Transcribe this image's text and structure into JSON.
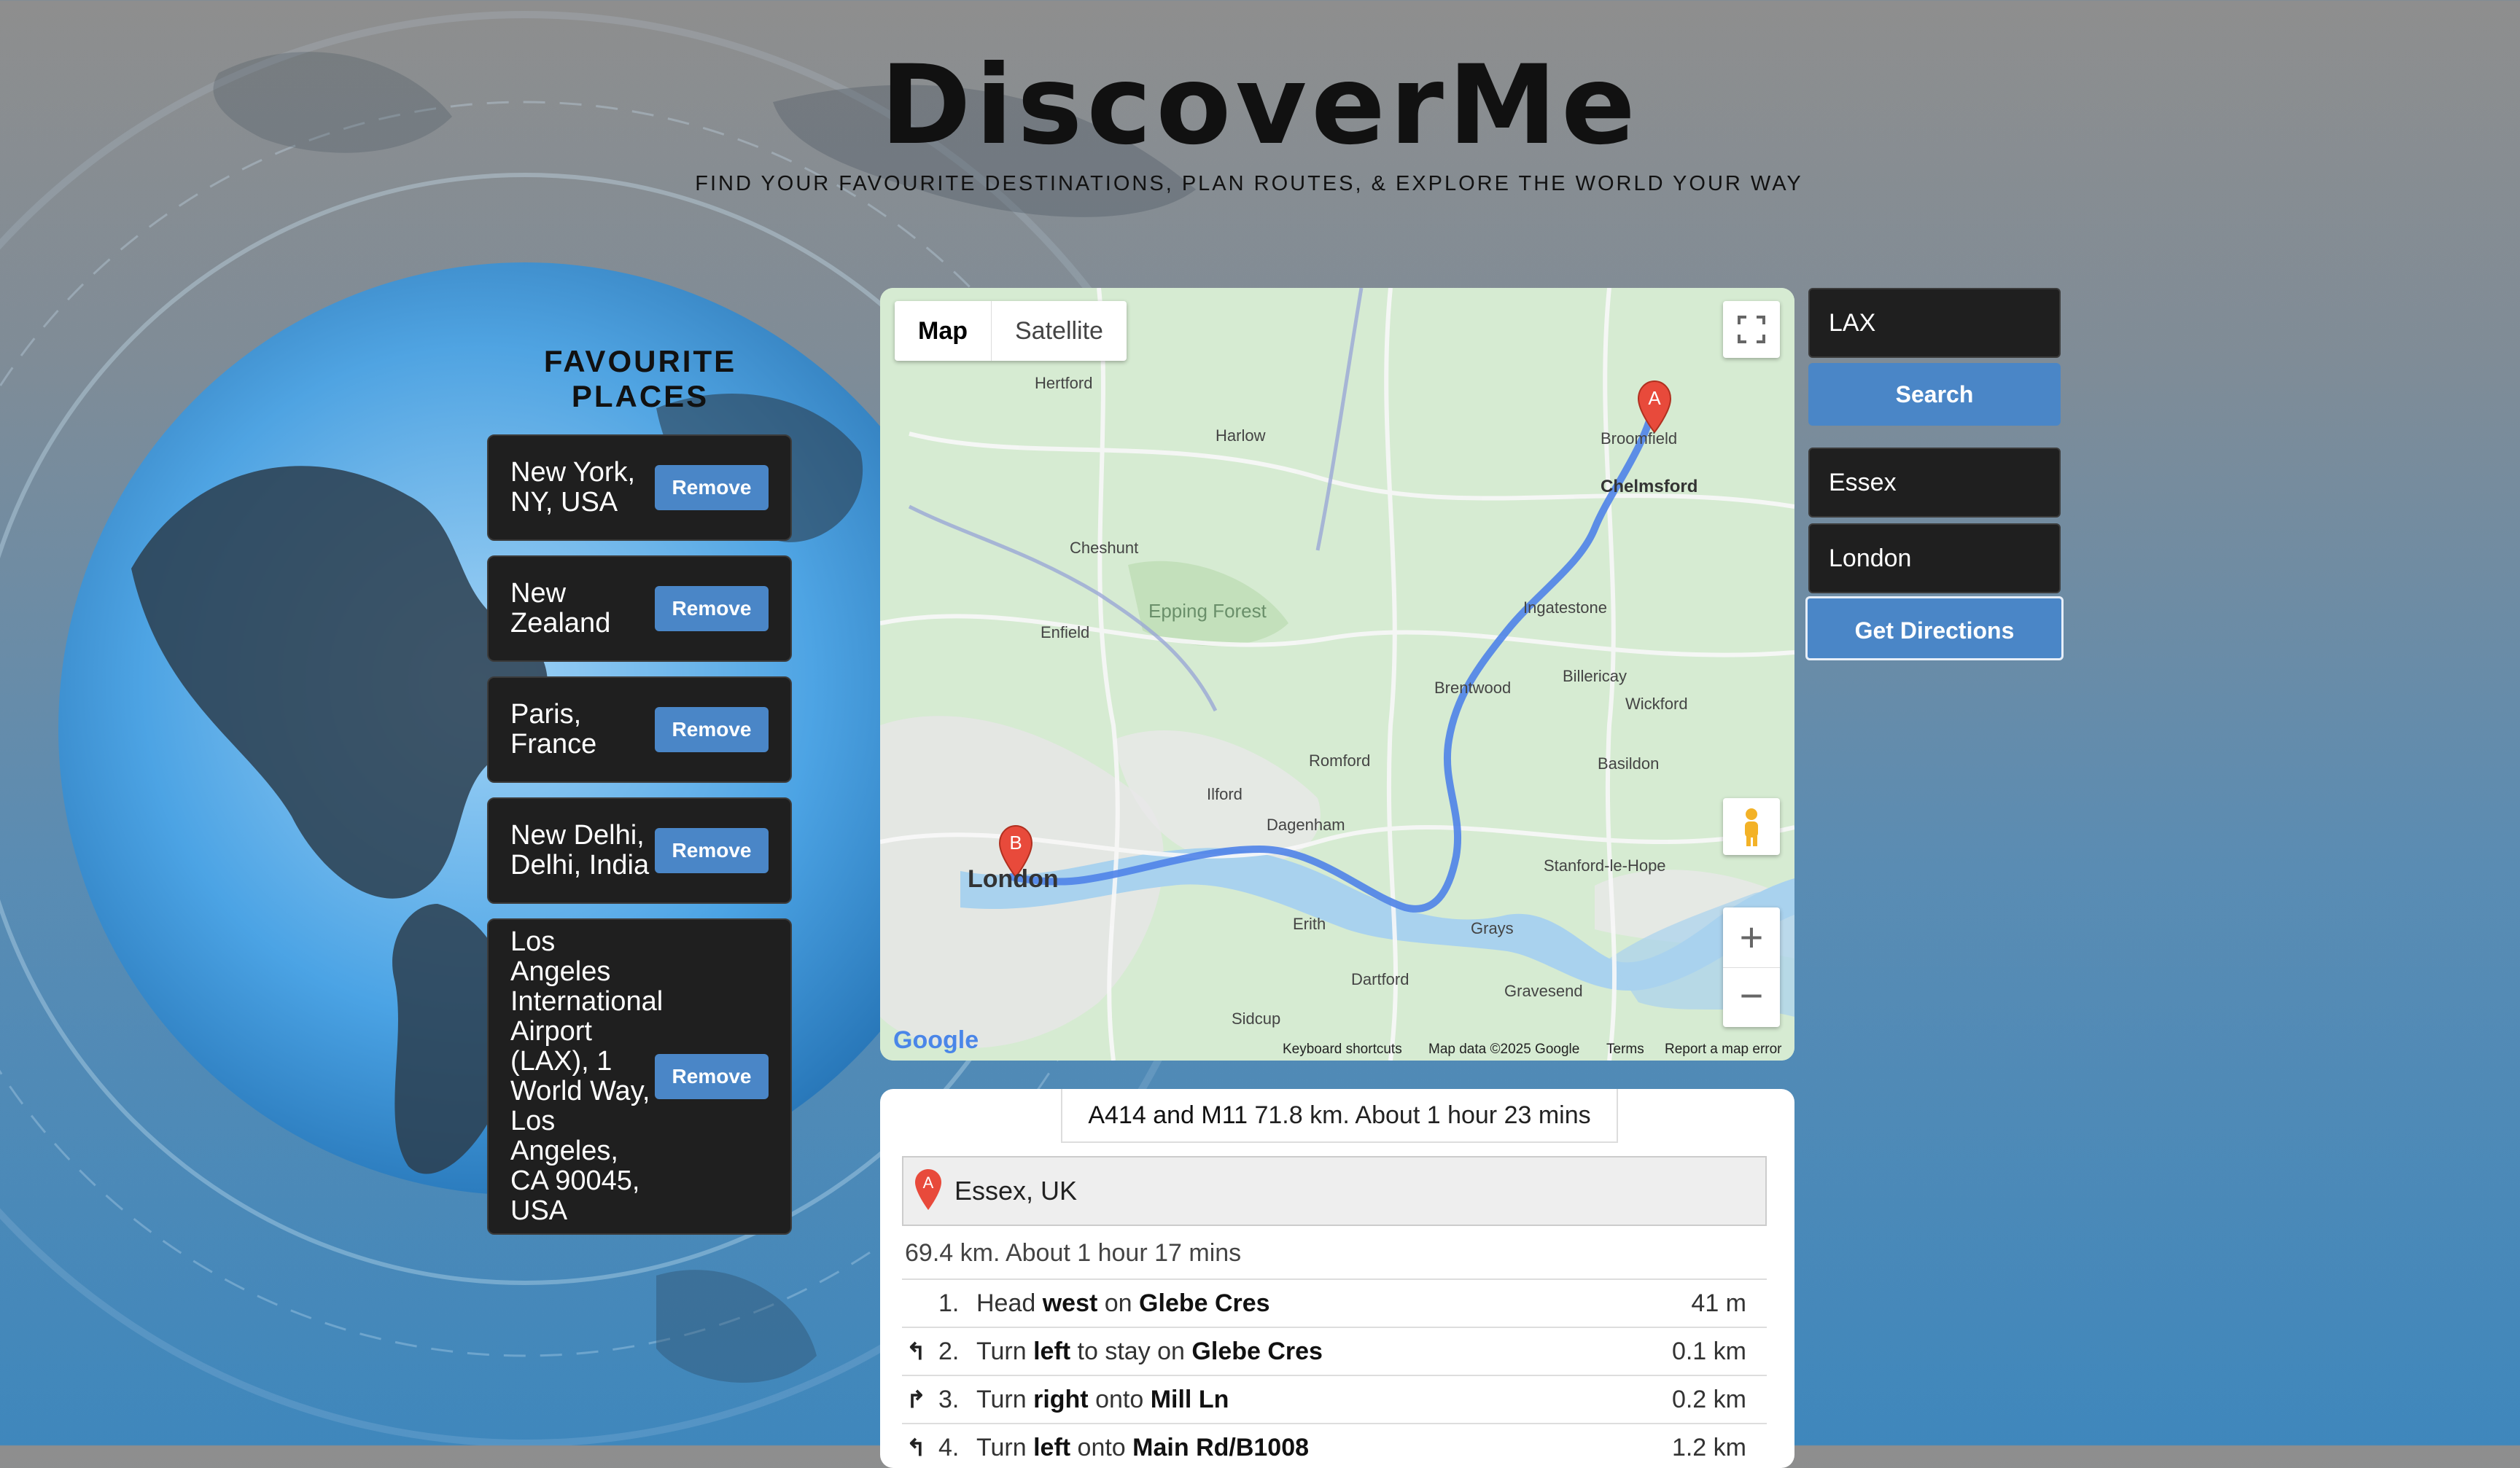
{
  "header": {
    "title": "DiscoverMe",
    "tagline": "FIND YOUR FAVOURITE DESTINATIONS, PLAN ROUTES, & EXPLORE THE WORLD YOUR WAY"
  },
  "favourites": {
    "title": "FAVOURITE PLACES",
    "remove_label": "Remove",
    "items": [
      {
        "name": "New York, NY, USA"
      },
      {
        "name": "New Zealand"
      },
      {
        "name": "Paris, France"
      },
      {
        "name": "New Delhi, Delhi, India"
      },
      {
        "name": "Los Angeles International Airport (LAX), 1 World Way, Los Angeles, CA 90045, USA"
      }
    ]
  },
  "map": {
    "tabs": [
      "Map",
      "Satellite"
    ],
    "labels": {
      "london": "London",
      "chelmsford": "Chelmsford",
      "epping_forest": "Epping Forest",
      "harlow": "Harlow",
      "brentwood": "Brentwood",
      "romford": "Romford",
      "dagenham": "Dagenham",
      "basildon": "Basildon",
      "enfield": "Enfield",
      "ilford": "Ilford",
      "hertford": "Hertford",
      "billericay": "Billericay",
      "dartford": "Dartford",
      "sidcup": "Sidcup",
      "broomfield": "Broomfield",
      "stanford": "Stanford-le-Hope",
      "gravesend": "Gravesend",
      "grays": "Grays",
      "erith": "Erith",
      "cheshunt": "Cheshunt",
      "wickford": "Wickford",
      "ingatestone": "Ingatestone"
    },
    "marker_a": "A",
    "marker_b": "B",
    "footer": {
      "google": "Google",
      "shortcuts": "Keyboard shortcuts",
      "map_data": "Map data ©2025 Google",
      "terms": "Terms",
      "report": "Report a map error"
    }
  },
  "search": {
    "value": "LAX",
    "button": "Search"
  },
  "directions": {
    "origin_value": "Essex",
    "destination_value": "London",
    "button": "Get Directions"
  },
  "route": {
    "via": "A414 and M11",
    "summary_text": "71.8 km. About 1 hour 23 mins",
    "origin": "Essex, UK",
    "leg_summary": "69.4 km. About 1 hour 17 mins",
    "steps": [
      {
        "num": "1.",
        "pre": "Head ",
        "b1": "west",
        "mid": " on ",
        "b2": "Glebe Cres",
        "dist": "41 m",
        "arrow": ""
      },
      {
        "num": "2.",
        "pre": "Turn ",
        "b1": "left",
        "mid": " to stay on ",
        "b2": "Glebe Cres",
        "dist": "0.1 km",
        "arrow": "↰"
      },
      {
        "num": "3.",
        "pre": "Turn ",
        "b1": "right",
        "mid": " onto ",
        "b2": "Mill Ln",
        "dist": "0.2 km",
        "arrow": "↱"
      },
      {
        "num": "4.",
        "pre": "Turn ",
        "b1": "left",
        "mid": " onto ",
        "b2": "Main Rd/B1008",
        "dist": "1.2 km",
        "arrow": "↰"
      }
    ]
  }
}
